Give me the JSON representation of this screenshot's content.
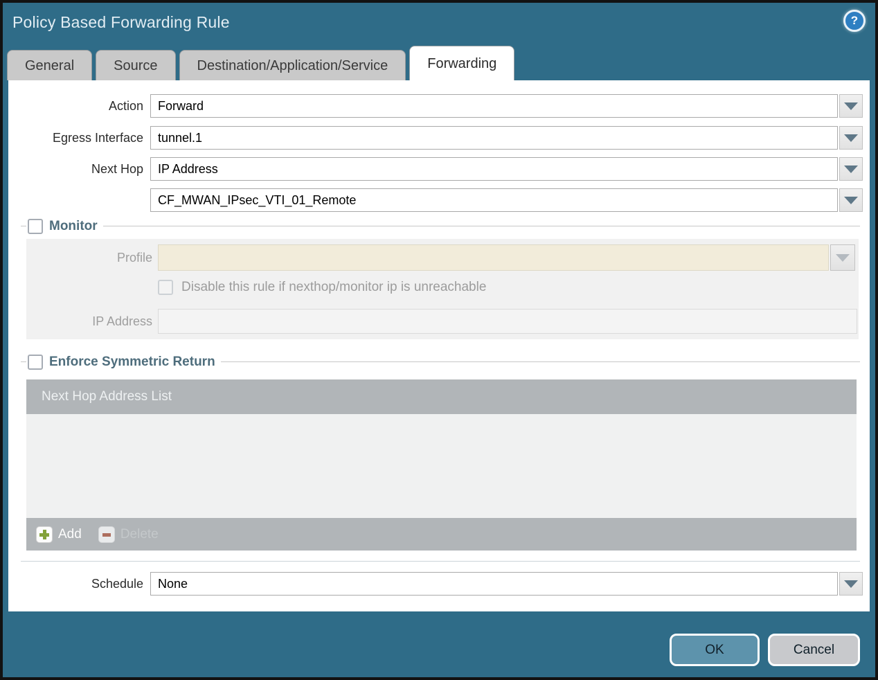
{
  "dialog": {
    "title": "Policy Based Forwarding Rule",
    "help_glyph": "?"
  },
  "tabs": [
    {
      "label": "General",
      "active": false
    },
    {
      "label": "Source",
      "active": false
    },
    {
      "label": "Destination/Application/Service",
      "active": false
    },
    {
      "label": "Forwarding",
      "active": true
    }
  ],
  "form": {
    "action": {
      "label": "Action",
      "value": "Forward"
    },
    "egress_interface": {
      "label": "Egress Interface",
      "value": "tunnel.1"
    },
    "next_hop": {
      "label": "Next Hop",
      "value": "IP Address"
    },
    "next_hop_address": {
      "value": "CF_MWAN_IPsec_VTI_01_Remote"
    },
    "monitor": {
      "label": "Monitor",
      "checked": false,
      "profile": {
        "label": "Profile",
        "value": ""
      },
      "disable_rule": {
        "label": "Disable this rule if nexthop/monitor ip is unreachable",
        "checked": false
      },
      "ip_address": {
        "label": "IP Address",
        "value": ""
      }
    },
    "enforce_symmetric_return": {
      "label": "Enforce Symmetric Return",
      "checked": false,
      "next_hop_address_list": {
        "header": "Next Hop Address List",
        "rows": [],
        "toolbar": {
          "add_label": "Add",
          "delete_label": "Delete",
          "delete_enabled": false
        }
      }
    },
    "schedule": {
      "label": "Schedule",
      "value": "None"
    }
  },
  "footer": {
    "ok_label": "OK",
    "cancel_label": "Cancel"
  },
  "icons": {
    "help": "question-mark-circle",
    "dropdown": "chevron-down-triangle",
    "add": "green-plus",
    "delete": "red-minus"
  },
  "colors": {
    "titlebar": "#2f6c88",
    "tab_inactive": "#c9c9c9",
    "tab_active": "#ffffff",
    "ok_button": "#5d93ac",
    "cancel_button": "#c8c9cc",
    "table_chrome": "#b1b5b8",
    "disabled_field": "#f2ecda",
    "group_title": "#4e6d7c"
  }
}
